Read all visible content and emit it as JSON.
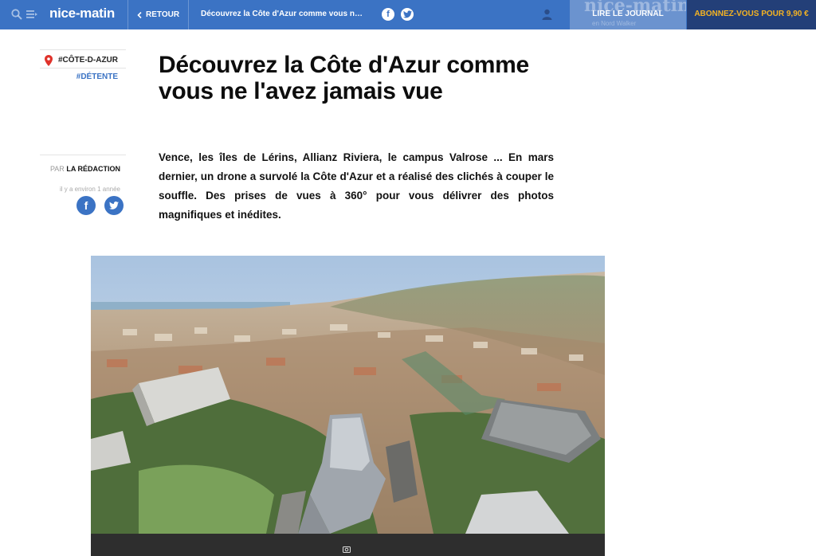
{
  "header": {
    "logo": "nice-matin",
    "back_label": "RETOUR",
    "article_title_short": "Découvrez la Côte d'Azur comme vous ne l'ave...",
    "facebook_glyph": "f",
    "journal_label": "LIRE LE JOURNAL",
    "journal_bg_title": "nice-matin",
    "journal_bg_sub": "en Nord Walker",
    "subscribe_label": "ABONNEZ-VOUS POUR 9,90 €",
    "colors": {
      "bar": "#3b73c4",
      "subscribe_bg": "#233f78",
      "subscribe_text": "#f4b323"
    }
  },
  "icons": {
    "search": "search-icon",
    "menu": "menu-icon",
    "back": "chevron-left-icon",
    "facebook": "facebook-icon",
    "twitter": "twitter-icon",
    "user": "user-icon",
    "pin": "location-pin-icon",
    "camera": "camera-icon"
  },
  "meta": {
    "tag_primary": "#CÔTE-D-AZUR",
    "tag_secondary": "#DÉTENTE",
    "author_prefix": "PAR",
    "author_name": "LA RÉDACTION",
    "time_ago": "il y a environ 1 année",
    "share_facebook_glyph": "f"
  },
  "article": {
    "headline": "Découvrez la Côte d'Azur comme vous ne l'avez jamais vue",
    "lede": "Vence, les îles de Lérins, Allianz Riviera, le campus Valrose ... En mars dernier, un drone a survolé la Côte d'Azur et a réalisé des clichés à couper le souffle. Des prises de vues à 360° pour vous délivrer des photos magnifiques et inédites."
  }
}
